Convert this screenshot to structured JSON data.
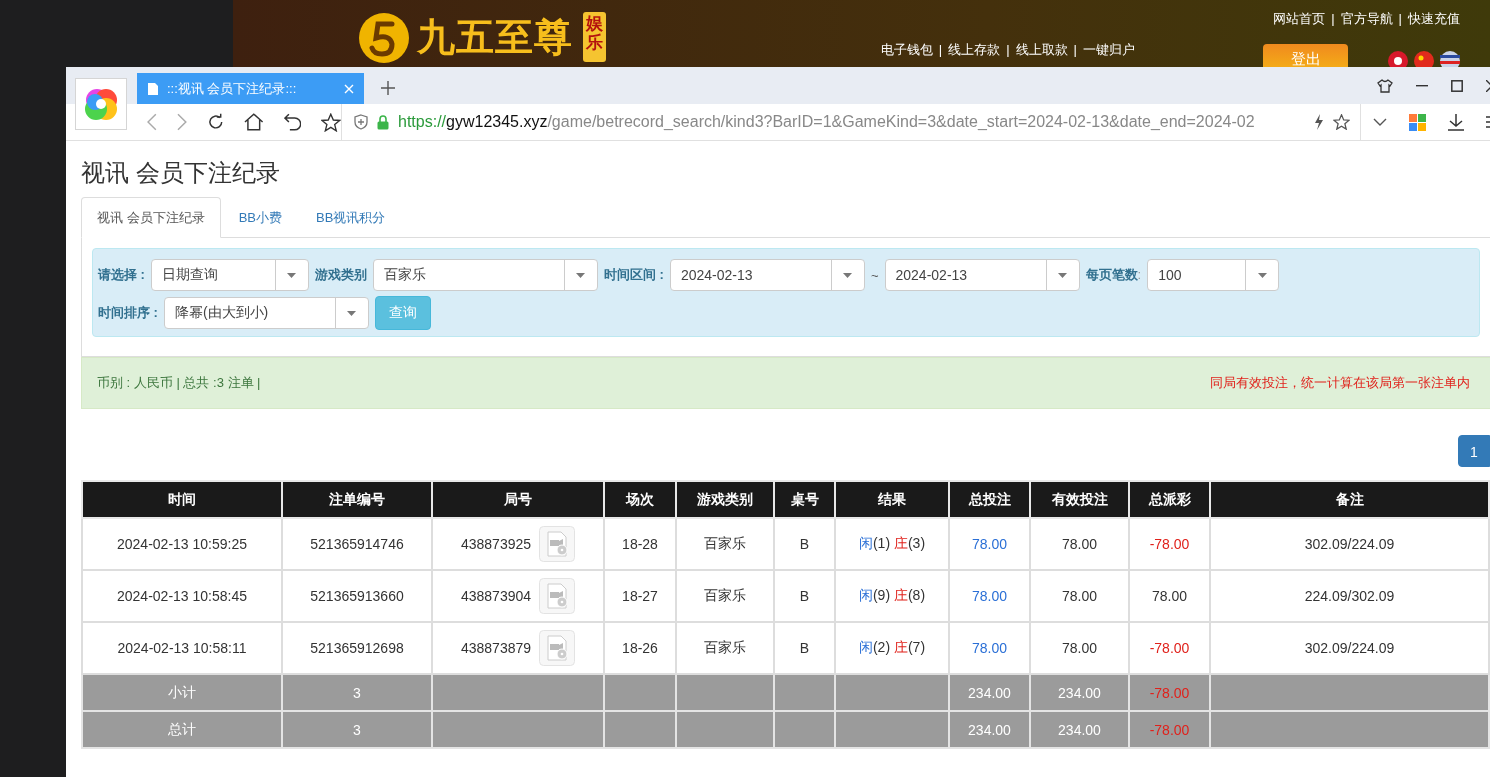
{
  "banner": {
    "brand": "九五至尊",
    "brand_tag": "娱乐",
    "top_links": [
      {
        "label": "网站首页"
      },
      {
        "separator": "|",
        "label": "官方导航"
      },
      {
        "separator": "|",
        "label": "快速充值"
      }
    ],
    "links": [
      {
        "label": "电子钱包"
      },
      {
        "separator": "|",
        "label": "线上存款"
      },
      {
        "separator": "|",
        "label": "线上取款"
      },
      {
        "separator": "|",
        "label": "一键归户"
      }
    ],
    "logout": "登出"
  },
  "browser": {
    "tabs": [
      {
        "title": ":::视讯 会员下注纪录:::",
        "selected": true
      }
    ],
    "url": {
      "scheme": "https://",
      "host": "gyw12345.xyz",
      "path": "/game/betrecord_search/kind3?BarID=1&GameKind=3&date_start=2024-02-13&date_end=2024-02"
    }
  },
  "page": {
    "title": "视讯 会员下注纪录",
    "tabs": [
      {
        "label": "视讯 会员下注纪录",
        "selected": true
      },
      {
        "label": "BB小费",
        "selected": false
      },
      {
        "label": "BB视讯积分",
        "selected": false
      }
    ]
  },
  "filters": [
    {
      "kind": "select",
      "label": "请选择 :",
      "value": "日期查询"
    },
    {
      "kind": "select",
      "label": "游戏类别",
      "value": "百家乐"
    },
    {
      "kind": "range",
      "label": "时间区间 :",
      "from": "2024-02-13",
      "separator": "~",
      "to": "2024-02-13"
    },
    {
      "kind": "select",
      "label": "每页笔数",
      "colon": ":",
      "value": "100"
    },
    {
      "kind": "select",
      "label": "时间排序 :",
      "value": "降幂(由大到小)"
    },
    {
      "kind": "button",
      "label": "查询"
    }
  ],
  "alert": {
    "summary": "币别 : 人民币 | 总共 :3 注单 |",
    "notice": "同局有效投注，统一计算在该局第一张注单内"
  },
  "pagination": [
    {
      "label": "1",
      "selected": true
    }
  ],
  "table": {
    "columns": [
      "时间",
      "注单编号",
      "局号",
      "场次",
      "游戏类别",
      "桌号",
      "结果",
      "总投注",
      "有效投注",
      "总派彩",
      "备注"
    ],
    "rows": [
      {
        "time": "2024-02-13 10:59:25",
        "bet_no": "521365914746",
        "round": "438873925",
        "session": "18-28",
        "game": "百家乐",
        "table": "B",
        "player": "闲",
        "player_score": "(1)",
        "banker": "庄",
        "banker_score": "(3)",
        "bet": "78.00",
        "valid_bet": "78.00",
        "payout": "-78.00",
        "loss": true,
        "note": "302.09/224.09"
      },
      {
        "time": "2024-02-13 10:58:45",
        "bet_no": "521365913660",
        "round": "438873904",
        "session": "18-27",
        "game": "百家乐",
        "table": "B",
        "player": "闲",
        "player_score": "(9)",
        "banker": "庄",
        "banker_score": "(8)",
        "bet": "78.00",
        "valid_bet": "78.00",
        "payout": "78.00",
        "loss": false,
        "note": "224.09/302.09"
      },
      {
        "time": "2024-02-13 10:58:11",
        "bet_no": "521365912698",
        "round": "438873879",
        "session": "18-26",
        "game": "百家乐",
        "table": "B",
        "player": "闲",
        "player_score": "(2)",
        "banker": "庄",
        "banker_score": "(7)",
        "bet": "78.00",
        "valid_bet": "78.00",
        "payout": "-78.00",
        "loss": true,
        "note": "302.09/224.09"
      }
    ],
    "totals": [
      {
        "label": "小计",
        "count": "3",
        "bet": "234.00",
        "valid_bet": "234.00",
        "payout": "-78.00",
        "loss": true
      },
      {
        "label": "总计",
        "count": "3",
        "bet": "234.00",
        "valid_bet": "234.00",
        "payout": "-78.00",
        "loss": true
      }
    ]
  }
}
